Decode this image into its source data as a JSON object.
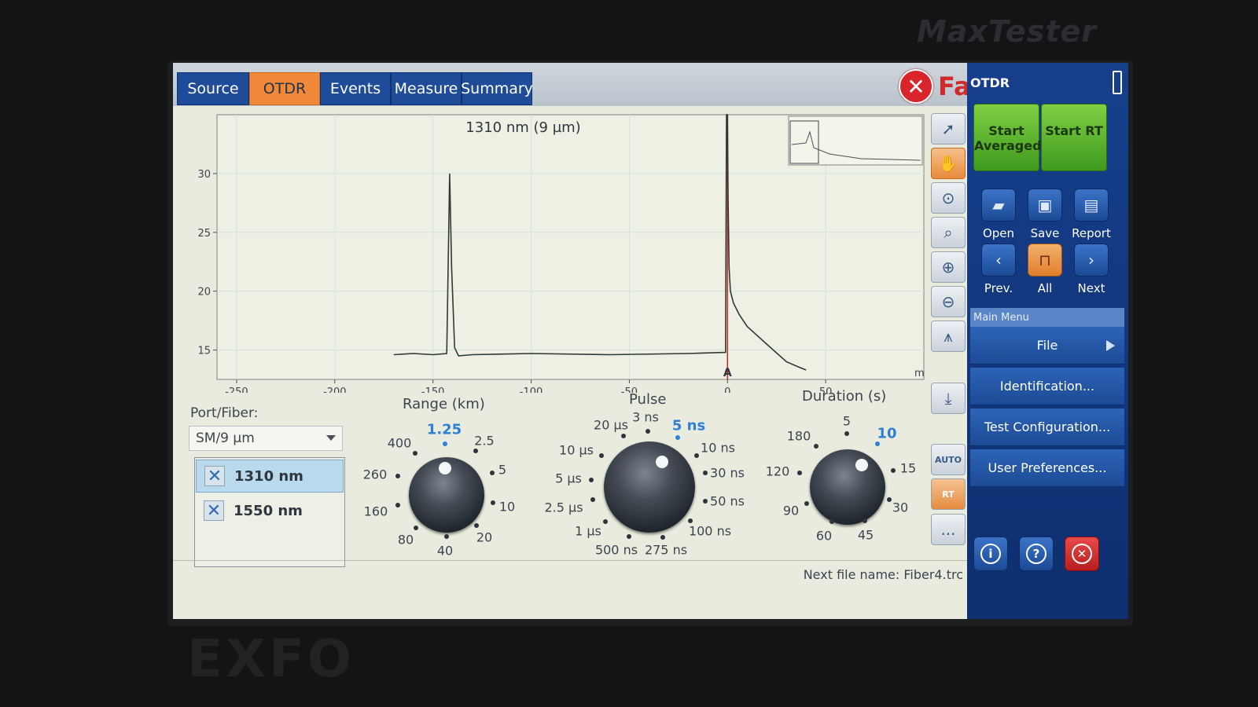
{
  "device": {
    "model": "MaxTester",
    "maker": "EXFO"
  },
  "tabs": [
    {
      "label": "Source"
    },
    {
      "label": "OTDR"
    },
    {
      "label": "Events"
    },
    {
      "label": "Measure"
    },
    {
      "label": "Summary"
    }
  ],
  "active_tab": "OTDR",
  "status": {
    "label": "Fail",
    "color": "#d12a2a"
  },
  "chart_data": {
    "type": "line",
    "title": "1310 nm (9 µm)",
    "x_unit": "m",
    "x_ticks": [
      -250,
      -200,
      -150,
      -100,
      -50,
      0,
      50
    ],
    "y_ticks": [
      15,
      20,
      25,
      30
    ],
    "xlim": [
      -260,
      100
    ],
    "ylim": [
      12.5,
      35
    ],
    "marker_label": "A",
    "marker_x": 0,
    "series": [
      {
        "color": "#2f3a33",
        "x": [
          -170,
          -160,
          -150,
          -143,
          -141.5,
          -140.5,
          -139,
          -137,
          -130,
          -100,
          -60,
          -20,
          -1,
          -0.5,
          0,
          0.3,
          0.8,
          1.5,
          3,
          6,
          10,
          20,
          30,
          37,
          40
        ],
        "y": [
          14.6,
          14.7,
          14.6,
          14.7,
          30,
          22,
          15.2,
          14.5,
          14.6,
          14.7,
          14.6,
          14.7,
          14.8,
          35,
          35,
          28,
          22,
          20,
          19,
          18,
          17,
          15.5,
          14,
          13.5,
          13.3
        ]
      }
    ],
    "grid": true,
    "legend": "none"
  },
  "port": {
    "label": "Port/Fiber:",
    "value": "SM/9 µm"
  },
  "wavelengths": [
    {
      "label": "1310 nm",
      "checked": true,
      "selected": true
    },
    {
      "label": "1550 nm",
      "checked": true,
      "selected": false
    }
  ],
  "knobs": {
    "range": {
      "title": "Range (km)",
      "options": [
        "400",
        "1.25",
        "2.5",
        "5",
        "10",
        "20",
        "40",
        "80",
        "160",
        "260"
      ],
      "selected": "1.25"
    },
    "pulse": {
      "title": "Pulse",
      "options": [
        "20 µs",
        "3 ns",
        "5 ns",
        "10 ns",
        "30 ns",
        "50 ns",
        "100 ns",
        "275 ns",
        "500 ns",
        "1 µs",
        "2.5 µs",
        "5 µs",
        "10 µs"
      ],
      "selected": "5 ns"
    },
    "duration": {
      "title": "Duration (s)",
      "options": [
        "180",
        "5",
        "10",
        "15",
        "30",
        "45",
        "60",
        "90",
        "120"
      ],
      "selected": "10"
    }
  },
  "next_file": "Next file name: Fiber4.trc",
  "side": {
    "title": "OTDR",
    "start_averaged": "Start Averaged",
    "start_rt": "Start RT",
    "buttons": [
      {
        "label": "Open",
        "icon": "folder-open-icon"
      },
      {
        "label": "Save",
        "icon": "save-icon"
      },
      {
        "label": "Report",
        "icon": "report-icon"
      },
      {
        "label": "Prev.",
        "icon": "previous-icon"
      },
      {
        "label": "All",
        "icon": "trace-all-icon"
      },
      {
        "label": "Next",
        "icon": "next-icon"
      }
    ],
    "main_menu_header": "Main Menu",
    "menu": [
      {
        "label": "File"
      },
      {
        "label": "Identification..."
      },
      {
        "label": "Test Configuration..."
      },
      {
        "label": "User Preferences..."
      }
    ]
  },
  "tools": {
    "auto_label": "AUTO",
    "rt_label": "RT",
    "more_label": "..."
  }
}
